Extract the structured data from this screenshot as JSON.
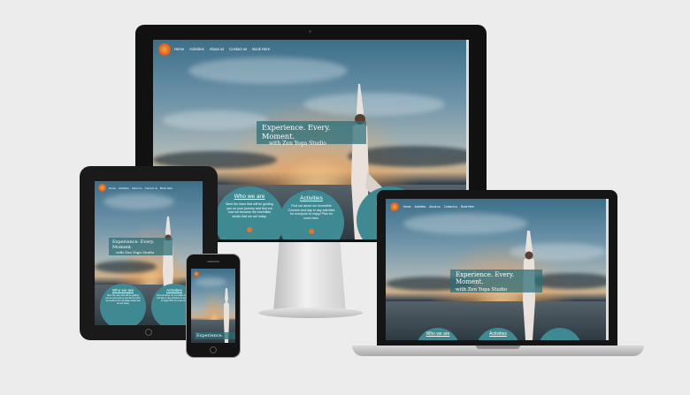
{
  "nav": {
    "items": [
      "Home",
      "Activities",
      "About us",
      "Contact us",
      "Book Here"
    ]
  },
  "hero": {
    "line1": "Experience. Every. Moment.",
    "line2": "with Zen Yoga Studio"
  },
  "sections": [
    {
      "title": "Who we are",
      "text_desktop": "Meet the team that will be guiding you on your journey and find out how we became the incredible studio that we are today."
    },
    {
      "title": "Activities",
      "text_desktop": "Find out about our incredible Courses and day to day activities for everyone to enjoy! Plan for more here."
    },
    {
      "title": "B",
      "text_desktop": "Join Incredible Book"
    }
  ],
  "tablet_texts": {
    "who": "Meet the team that will be guiding you on your journey and find out how we became the incredible studio that we are today.",
    "activities": "Find out about our incredible Courses and day to day activities for everyone to enjoy! Plan for more here."
  },
  "phone": {
    "hero_line": "Experience."
  },
  "colors": {
    "accent": "#3f8a92",
    "overlay": "#286e78",
    "logo": "#e3752b",
    "background": "#ececec"
  }
}
